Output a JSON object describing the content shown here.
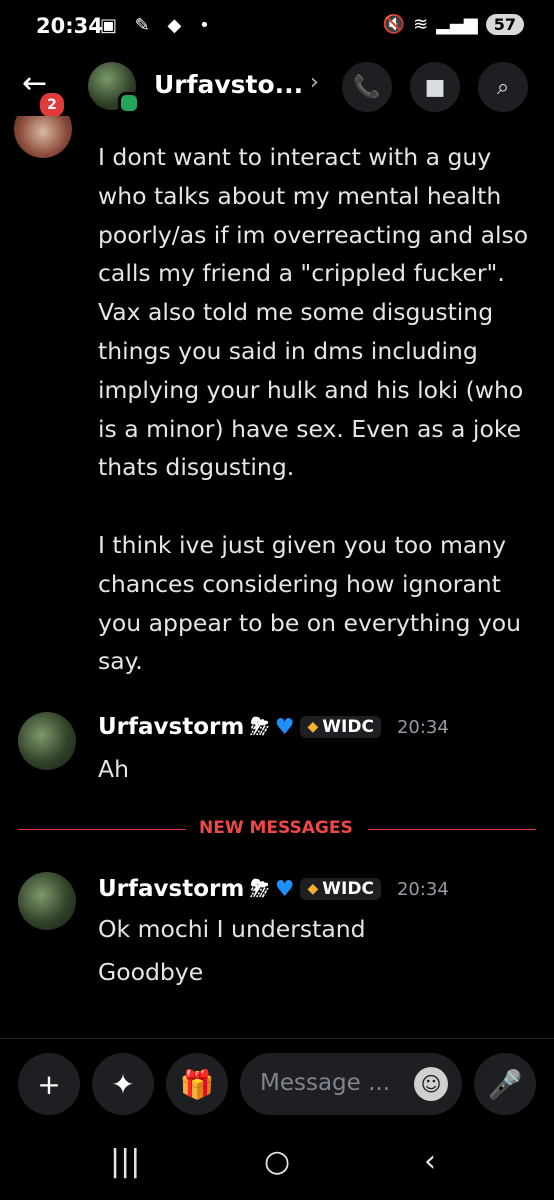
{
  "status": {
    "time": "20:34",
    "battery": "57"
  },
  "header": {
    "title": "Urfavsto...",
    "badge": "2"
  },
  "messages": {
    "top_text": "I dont want to interact with a guy\nwho talks about my mental health\npoorly/as if im overreacting and also\ncalls my friend a \"crippled fucker\".\nVax also told me some disgusting\nthings you said in dms including\nimplying your hulk and his loki (who\nis a minor) have sex. Even as a joke\nthats disgusting.\n\nI think ive just given you too many\nchances considering how ignorant\nyou appear to be on everything you\nsay.",
    "msg1": {
      "author": "Urfavstorm",
      "tag": "WIDC",
      "time": "20:34",
      "text": "Ah"
    },
    "divider": "NEW MESSAGES",
    "msg2": {
      "author": "Urfavstorm",
      "tag": "WIDC",
      "time": "20:34",
      "line1": "Ok mochi I understand",
      "line2": "Goodbye"
    }
  },
  "composer": {
    "placeholder": "Message ..."
  },
  "icons": [
    "back-arrow-icon",
    "call-icon",
    "video-icon",
    "search-icon",
    "plus-icon",
    "apps-icon",
    "gift-icon",
    "emoji-icon",
    "mic-icon"
  ],
  "colors": {
    "accent_red": "#f04747",
    "online": "#23a55a",
    "heart": "#1e90ff"
  }
}
